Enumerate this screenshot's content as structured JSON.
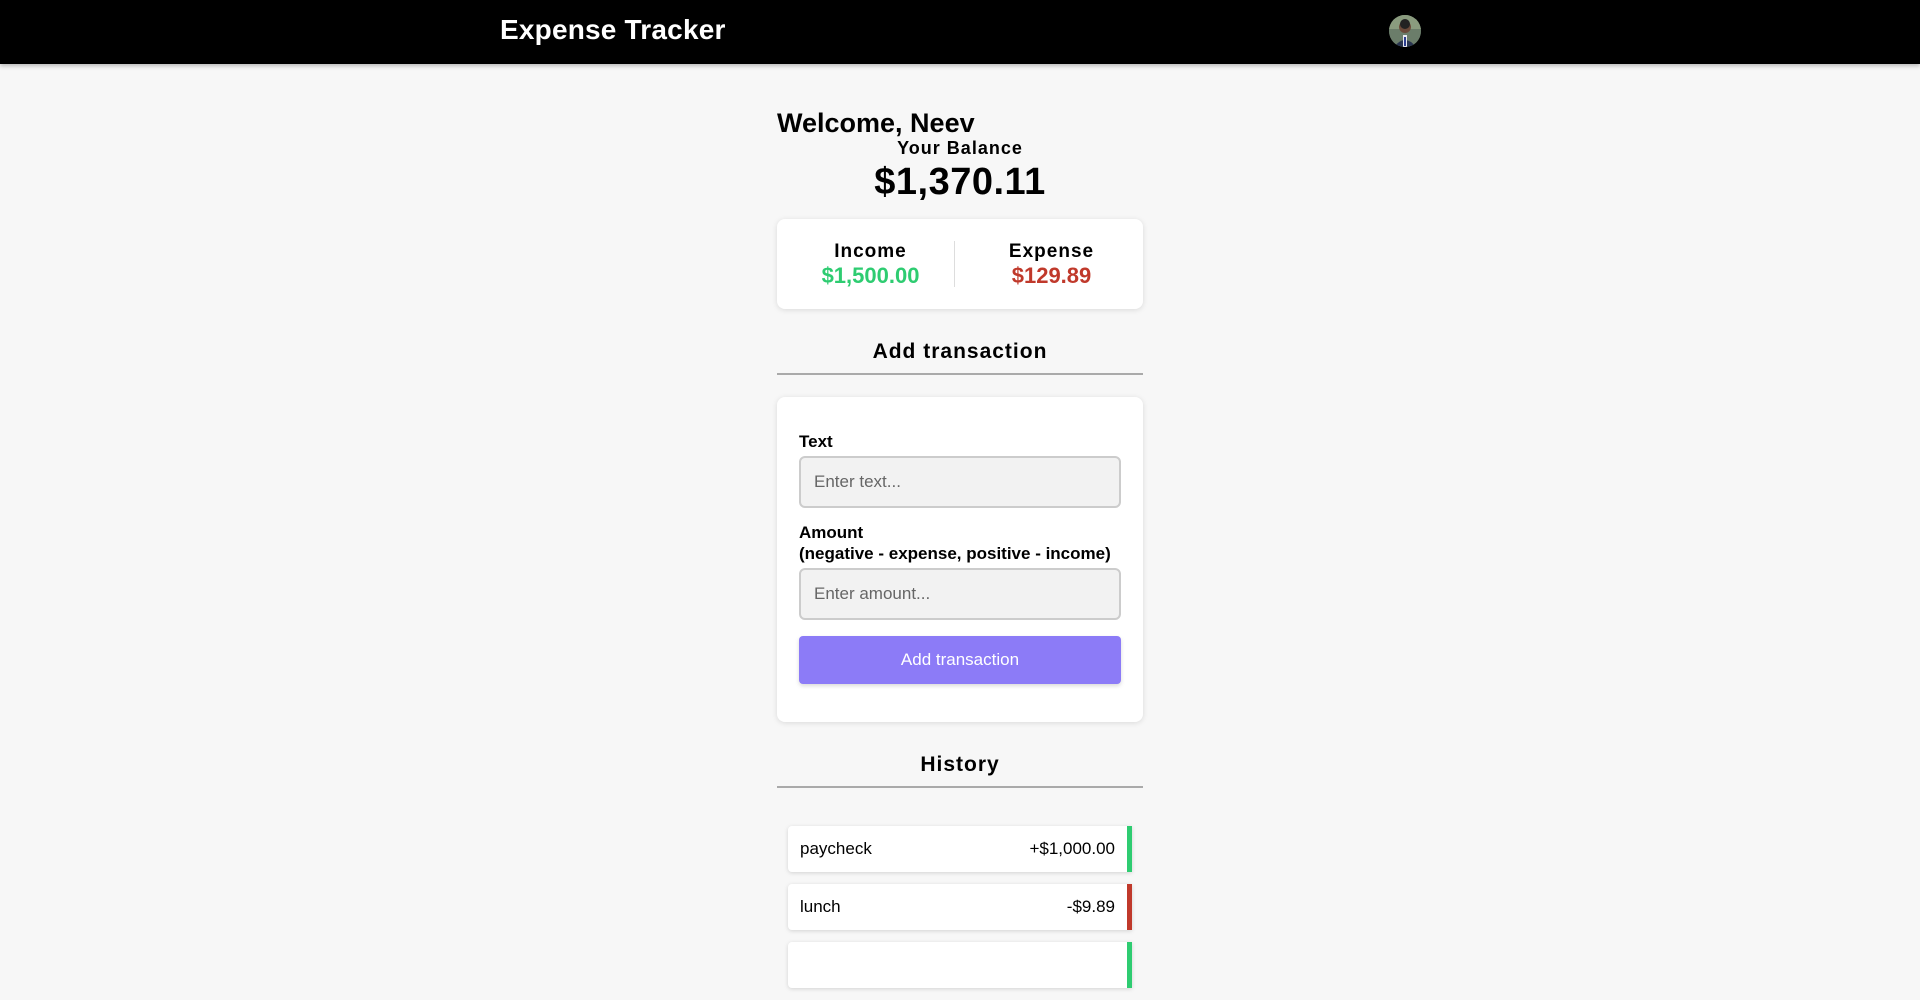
{
  "header": {
    "title": "Expense Tracker",
    "avatar_icon": "user-avatar"
  },
  "welcome": "Welcome, Neev",
  "balance": {
    "label": "Your Balance",
    "value": "$1,370.11"
  },
  "summary": {
    "income_label": "Income",
    "income_value": "$1,500.00",
    "expense_label": "Expense",
    "expense_value": "$129.89",
    "income_color": "#2ecc71",
    "expense_color": "#c0392b"
  },
  "add_section": {
    "title": "Add transaction",
    "text_label": "Text",
    "text_placeholder": "Enter text...",
    "amount_label": "Amount",
    "amount_hint": "(negative - expense, positive - income)",
    "amount_placeholder": "Enter amount...",
    "button_label": "Add transaction",
    "button_color": "#8c7bf7"
  },
  "history": {
    "title": "History",
    "items": [
      {
        "text": "paycheck",
        "amount": "+$1,000.00",
        "type": "plus"
      },
      {
        "text": "lunch",
        "amount": "-$9.89",
        "type": "minus"
      }
    ]
  }
}
